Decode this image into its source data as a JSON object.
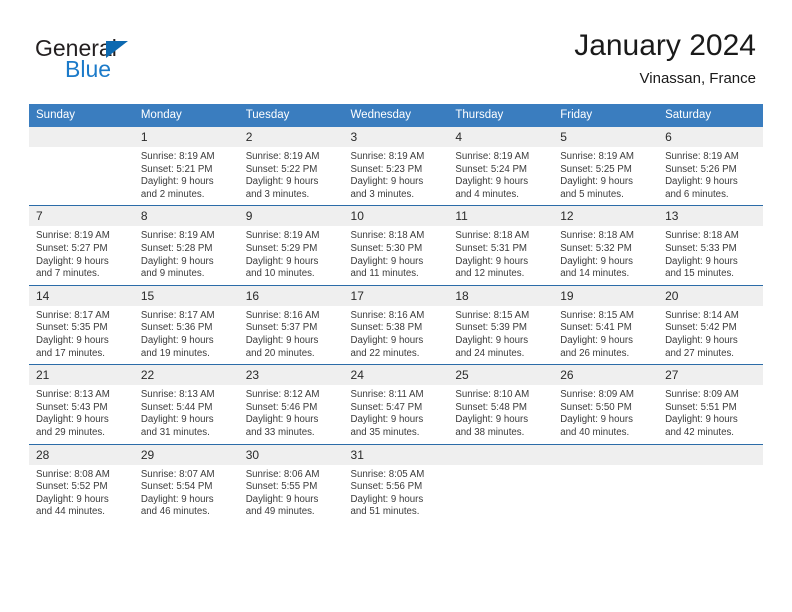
{
  "brand": {
    "name_part1": "General",
    "name_part2": "Blue",
    "triangle_color": "#0d69b0",
    "blue_color": "#1b7ac9"
  },
  "header": {
    "title": "January 2024",
    "subtitle": "Vinassan, France"
  },
  "theme": {
    "header_blue": "#3a7dbf",
    "separator_blue": "#2b6ca8",
    "daynum_band": "#efefef"
  },
  "weekday_headers": [
    "Sunday",
    "Monday",
    "Tuesday",
    "Wednesday",
    "Thursday",
    "Friday",
    "Saturday"
  ],
  "weeks": [
    [
      {
        "day": "",
        "sunrise": "",
        "sunset": "",
        "daylight1": "",
        "daylight2": ""
      },
      {
        "day": "1",
        "sunrise": "Sunrise: 8:19 AM",
        "sunset": "Sunset: 5:21 PM",
        "daylight1": "Daylight: 9 hours",
        "daylight2": "and 2 minutes."
      },
      {
        "day": "2",
        "sunrise": "Sunrise: 8:19 AM",
        "sunset": "Sunset: 5:22 PM",
        "daylight1": "Daylight: 9 hours",
        "daylight2": "and 3 minutes."
      },
      {
        "day": "3",
        "sunrise": "Sunrise: 8:19 AM",
        "sunset": "Sunset: 5:23 PM",
        "daylight1": "Daylight: 9 hours",
        "daylight2": "and 3 minutes."
      },
      {
        "day": "4",
        "sunrise": "Sunrise: 8:19 AM",
        "sunset": "Sunset: 5:24 PM",
        "daylight1": "Daylight: 9 hours",
        "daylight2": "and 4 minutes."
      },
      {
        "day": "5",
        "sunrise": "Sunrise: 8:19 AM",
        "sunset": "Sunset: 5:25 PM",
        "daylight1": "Daylight: 9 hours",
        "daylight2": "and 5 minutes."
      },
      {
        "day": "6",
        "sunrise": "Sunrise: 8:19 AM",
        "sunset": "Sunset: 5:26 PM",
        "daylight1": "Daylight: 9 hours",
        "daylight2": "and 6 minutes."
      }
    ],
    [
      {
        "day": "7",
        "sunrise": "Sunrise: 8:19 AM",
        "sunset": "Sunset: 5:27 PM",
        "daylight1": "Daylight: 9 hours",
        "daylight2": "and 7 minutes."
      },
      {
        "day": "8",
        "sunrise": "Sunrise: 8:19 AM",
        "sunset": "Sunset: 5:28 PM",
        "daylight1": "Daylight: 9 hours",
        "daylight2": "and 9 minutes."
      },
      {
        "day": "9",
        "sunrise": "Sunrise: 8:19 AM",
        "sunset": "Sunset: 5:29 PM",
        "daylight1": "Daylight: 9 hours",
        "daylight2": "and 10 minutes."
      },
      {
        "day": "10",
        "sunrise": "Sunrise: 8:18 AM",
        "sunset": "Sunset: 5:30 PM",
        "daylight1": "Daylight: 9 hours",
        "daylight2": "and 11 minutes."
      },
      {
        "day": "11",
        "sunrise": "Sunrise: 8:18 AM",
        "sunset": "Sunset: 5:31 PM",
        "daylight1": "Daylight: 9 hours",
        "daylight2": "and 12 minutes."
      },
      {
        "day": "12",
        "sunrise": "Sunrise: 8:18 AM",
        "sunset": "Sunset: 5:32 PM",
        "daylight1": "Daylight: 9 hours",
        "daylight2": "and 14 minutes."
      },
      {
        "day": "13",
        "sunrise": "Sunrise: 8:18 AM",
        "sunset": "Sunset: 5:33 PM",
        "daylight1": "Daylight: 9 hours",
        "daylight2": "and 15 minutes."
      }
    ],
    [
      {
        "day": "14",
        "sunrise": "Sunrise: 8:17 AM",
        "sunset": "Sunset: 5:35 PM",
        "daylight1": "Daylight: 9 hours",
        "daylight2": "and 17 minutes."
      },
      {
        "day": "15",
        "sunrise": "Sunrise: 8:17 AM",
        "sunset": "Sunset: 5:36 PM",
        "daylight1": "Daylight: 9 hours",
        "daylight2": "and 19 minutes."
      },
      {
        "day": "16",
        "sunrise": "Sunrise: 8:16 AM",
        "sunset": "Sunset: 5:37 PM",
        "daylight1": "Daylight: 9 hours",
        "daylight2": "and 20 minutes."
      },
      {
        "day": "17",
        "sunrise": "Sunrise: 8:16 AM",
        "sunset": "Sunset: 5:38 PM",
        "daylight1": "Daylight: 9 hours",
        "daylight2": "and 22 minutes."
      },
      {
        "day": "18",
        "sunrise": "Sunrise: 8:15 AM",
        "sunset": "Sunset: 5:39 PM",
        "daylight1": "Daylight: 9 hours",
        "daylight2": "and 24 minutes."
      },
      {
        "day": "19",
        "sunrise": "Sunrise: 8:15 AM",
        "sunset": "Sunset: 5:41 PM",
        "daylight1": "Daylight: 9 hours",
        "daylight2": "and 26 minutes."
      },
      {
        "day": "20",
        "sunrise": "Sunrise: 8:14 AM",
        "sunset": "Sunset: 5:42 PM",
        "daylight1": "Daylight: 9 hours",
        "daylight2": "and 27 minutes."
      }
    ],
    [
      {
        "day": "21",
        "sunrise": "Sunrise: 8:13 AM",
        "sunset": "Sunset: 5:43 PM",
        "daylight1": "Daylight: 9 hours",
        "daylight2": "and 29 minutes."
      },
      {
        "day": "22",
        "sunrise": "Sunrise: 8:13 AM",
        "sunset": "Sunset: 5:44 PM",
        "daylight1": "Daylight: 9 hours",
        "daylight2": "and 31 minutes."
      },
      {
        "day": "23",
        "sunrise": "Sunrise: 8:12 AM",
        "sunset": "Sunset: 5:46 PM",
        "daylight1": "Daylight: 9 hours",
        "daylight2": "and 33 minutes."
      },
      {
        "day": "24",
        "sunrise": "Sunrise: 8:11 AM",
        "sunset": "Sunset: 5:47 PM",
        "daylight1": "Daylight: 9 hours",
        "daylight2": "and 35 minutes."
      },
      {
        "day": "25",
        "sunrise": "Sunrise: 8:10 AM",
        "sunset": "Sunset: 5:48 PM",
        "daylight1": "Daylight: 9 hours",
        "daylight2": "and 38 minutes."
      },
      {
        "day": "26",
        "sunrise": "Sunrise: 8:09 AM",
        "sunset": "Sunset: 5:50 PM",
        "daylight1": "Daylight: 9 hours",
        "daylight2": "and 40 minutes."
      },
      {
        "day": "27",
        "sunrise": "Sunrise: 8:09 AM",
        "sunset": "Sunset: 5:51 PM",
        "daylight1": "Daylight: 9 hours",
        "daylight2": "and 42 minutes."
      }
    ],
    [
      {
        "day": "28",
        "sunrise": "Sunrise: 8:08 AM",
        "sunset": "Sunset: 5:52 PM",
        "daylight1": "Daylight: 9 hours",
        "daylight2": "and 44 minutes."
      },
      {
        "day": "29",
        "sunrise": "Sunrise: 8:07 AM",
        "sunset": "Sunset: 5:54 PM",
        "daylight1": "Daylight: 9 hours",
        "daylight2": "and 46 minutes."
      },
      {
        "day": "30",
        "sunrise": "Sunrise: 8:06 AM",
        "sunset": "Sunset: 5:55 PM",
        "daylight1": "Daylight: 9 hours",
        "daylight2": "and 49 minutes."
      },
      {
        "day": "31",
        "sunrise": "Sunrise: 8:05 AM",
        "sunset": "Sunset: 5:56 PM",
        "daylight1": "Daylight: 9 hours",
        "daylight2": "and 51 minutes."
      },
      {
        "day": "",
        "sunrise": "",
        "sunset": "",
        "daylight1": "",
        "daylight2": ""
      },
      {
        "day": "",
        "sunrise": "",
        "sunset": "",
        "daylight1": "",
        "daylight2": ""
      },
      {
        "day": "",
        "sunrise": "",
        "sunset": "",
        "daylight1": "",
        "daylight2": ""
      }
    ]
  ]
}
